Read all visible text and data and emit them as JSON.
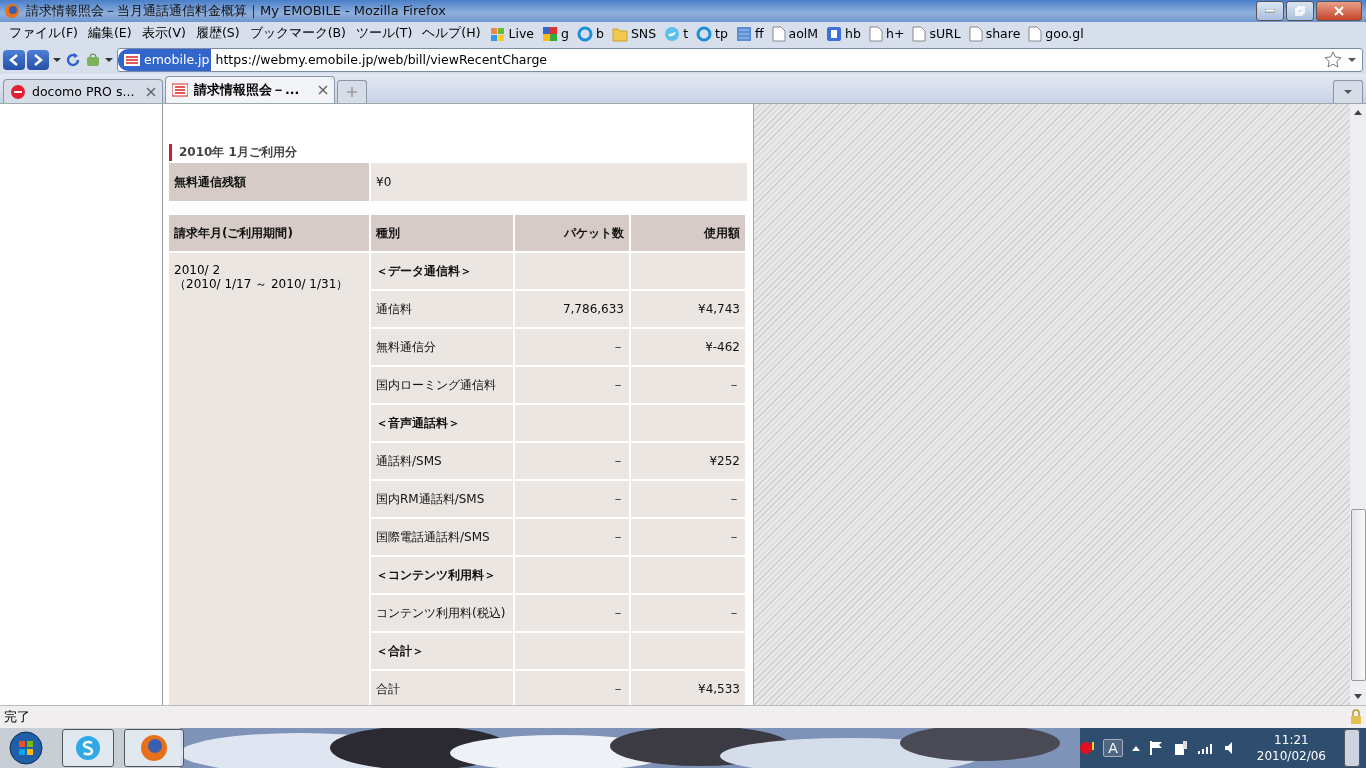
{
  "window": {
    "title": "請求情報照会－当月通話通信料金概算｜My EMOBILE - Mozilla Firefox"
  },
  "menu": [
    "ファイル(F)",
    "編集(E)",
    "表示(V)",
    "履歴(S)",
    "ブックマーク(B)",
    "ツール(T)",
    "ヘルプ(H)"
  ],
  "bookmarks": [
    {
      "label": "Live",
      "kind": "flag"
    },
    {
      "label": "g",
      "kind": "blocks"
    },
    {
      "label": "b",
      "kind": "ring"
    },
    {
      "label": "SNS",
      "kind": "folder"
    },
    {
      "label": "t",
      "kind": "bird"
    },
    {
      "label": "tp",
      "kind": "ring"
    },
    {
      "label": "ff",
      "kind": "tile"
    },
    {
      "label": "aolM",
      "kind": "page"
    },
    {
      "label": "hb",
      "kind": "square"
    },
    {
      "label": "h+",
      "kind": "page"
    },
    {
      "label": "sURL",
      "kind": "page"
    },
    {
      "label": "share",
      "kind": "page"
    },
    {
      "label": "goo.gl",
      "kind": "page"
    }
  ],
  "address": {
    "site": "emobile.jp",
    "url": "https://webmy.emobile.jp/web/bill/viewRecentCharge"
  },
  "tabs": [
    {
      "label": "docomo PRO s...",
      "selected": false,
      "kind": "dot"
    },
    {
      "label": "請求情報照会－...",
      "selected": true,
      "kind": "em"
    }
  ],
  "section": {
    "heading": "2010年  1月ご利用分"
  },
  "balance": {
    "label": "無料通信残額",
    "value": "¥0"
  },
  "table": {
    "columns": [
      "請求年月(ご利用期間)",
      "種別",
      "パケット数",
      "使用額"
    ],
    "period": [
      "2010/ 2",
      "（2010/ 1/17 ～ 2010/ 1/31）"
    ],
    "rows": [
      {
        "kind": "section",
        "type": "＜データ通信料＞"
      },
      {
        "kind": "item",
        "type": "通信料",
        "packets": "7,786,633",
        "amount": "¥4,743"
      },
      {
        "kind": "item",
        "type": "無料通信分",
        "packets": "－",
        "amount": "¥-462"
      },
      {
        "kind": "item",
        "type": "国内ローミング通信料",
        "packets": "－",
        "amount": "－"
      },
      {
        "kind": "section",
        "type": "＜音声通話料＞"
      },
      {
        "kind": "item",
        "type": "通話料/SMS",
        "packets": "－",
        "amount": "¥252"
      },
      {
        "kind": "item",
        "type": "国内RM通話料/SMS",
        "packets": "－",
        "amount": "－"
      },
      {
        "kind": "item",
        "type": "国際電話通話料/SMS",
        "packets": "－",
        "amount": "－"
      },
      {
        "kind": "section",
        "type": "＜コンテンツ利用料＞"
      },
      {
        "kind": "item",
        "type": "コンテンツ利用料(税込)",
        "packets": "－",
        "amount": "－"
      },
      {
        "kind": "section",
        "type": "＜合計＞"
      },
      {
        "kind": "item",
        "type": "合計",
        "packets": "－",
        "amount": "¥4,533"
      }
    ]
  },
  "status_bar": {
    "text": "完了"
  },
  "taskbar": {
    "time": "11:21",
    "date": "2010/02/06",
    "ime": "A"
  }
}
